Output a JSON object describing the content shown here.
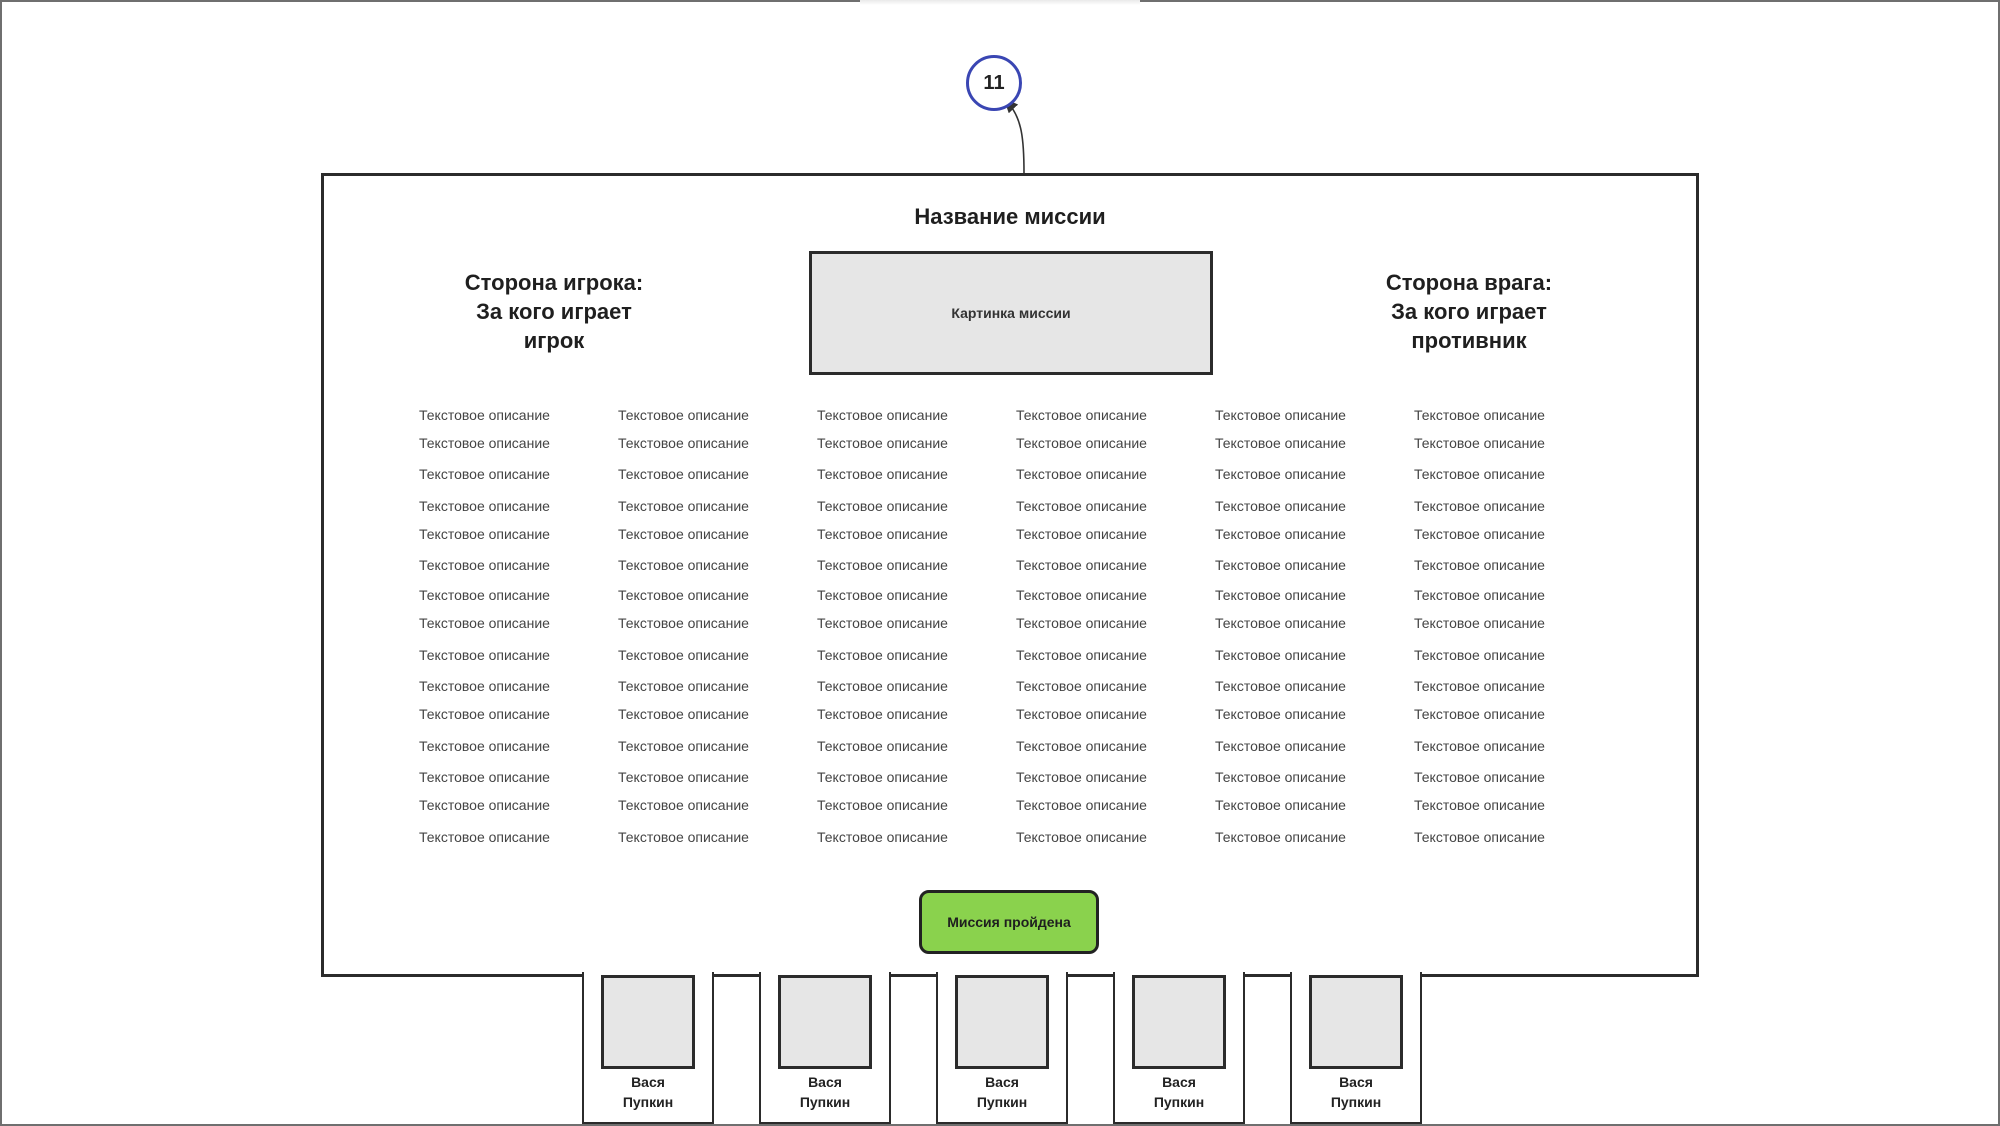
{
  "step_badge": "11",
  "mission": {
    "title": "Название миссии",
    "image_label": "Картинка миссии",
    "player_side": [
      "Сторона игрока:",
      "За кого играет",
      "игрок"
    ],
    "enemy_side": [
      "Сторона врага:",
      "За кого играет",
      "противник"
    ],
    "description_text": "Текстовое описание",
    "complete_button": "Миссия пройдена"
  },
  "characters": [
    {
      "first": "Вася",
      "last": "Пупкин"
    },
    {
      "first": "Вася",
      "last": "Пупкин"
    },
    {
      "first": "Вася",
      "last": "Пупкин"
    },
    {
      "first": "Вася",
      "last": "Пупкин"
    },
    {
      "first": "Вася",
      "last": "Пупкин"
    }
  ],
  "colors": {
    "badge_border": "#3a46b3",
    "button_fill": "#8ad24d",
    "image_fill": "#e6e6e6"
  }
}
